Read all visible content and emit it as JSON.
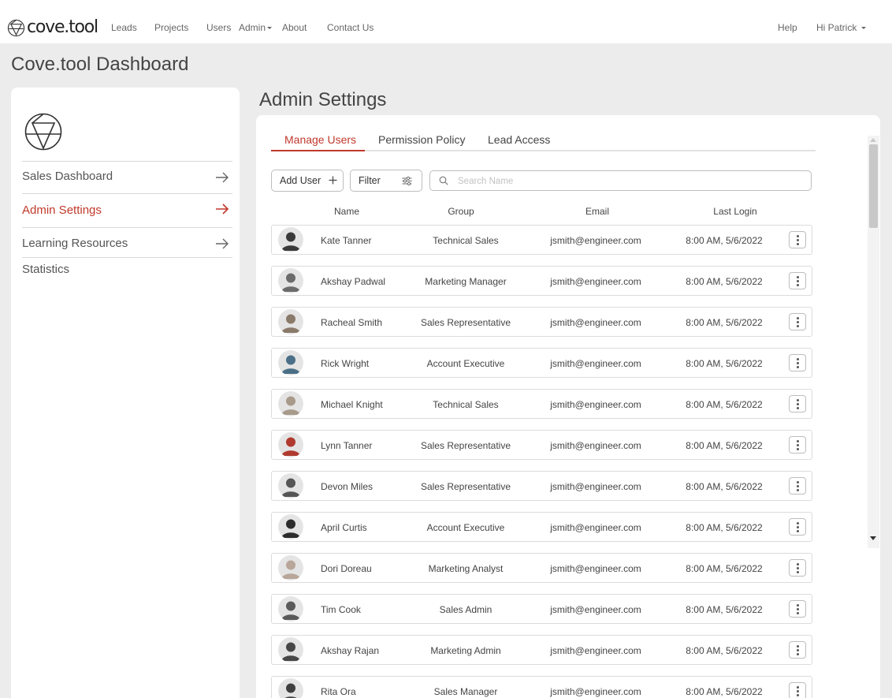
{
  "header": {
    "brand": "cove.tool",
    "nav": [
      "Leads",
      "Projects",
      "Users",
      "Admin",
      "About",
      "Contact Us"
    ],
    "help": "Help",
    "user_greeting": "Hi Patrick"
  },
  "page_title": "Cove.tool Dashboard",
  "sidebar": {
    "items": [
      {
        "label": "Sales Dashboard",
        "active": false
      },
      {
        "label": "Admin Settings",
        "active": true
      },
      {
        "label": "Learning Resources",
        "active": false
      },
      {
        "label": "Statistics",
        "active": false
      }
    ]
  },
  "main": {
    "title": "Admin Settings",
    "tabs": [
      {
        "label": "Manage Users",
        "active": true
      },
      {
        "label": "Permission Policy",
        "active": false
      },
      {
        "label": "Lead Access",
        "active": false
      }
    ],
    "add_user_label": "Add User",
    "filter_label": "Filter",
    "search": {
      "placeholder": "Search Name",
      "value": ""
    },
    "columns": [
      "Name",
      "Group",
      "Email",
      "Last Login"
    ],
    "rows": [
      {
        "name": "Kate Tanner",
        "group": "Technical Sales",
        "email": "jsmith@engineer.com",
        "last_login": "8:00 AM, 5/6/2022"
      },
      {
        "name": "Akshay Padwal",
        "group": "Marketing Manager",
        "email": "jsmith@engineer.com",
        "last_login": "8:00 AM, 5/6/2022"
      },
      {
        "name": "Racheal Smith",
        "group": "Sales Representative",
        "email": "jsmith@engineer.com",
        "last_login": "8:00 AM, 5/6/2022"
      },
      {
        "name": "Rick Wright",
        "group": "Account Executive",
        "email": "jsmith@engineer.com",
        "last_login": "8:00 AM, 5/6/2022"
      },
      {
        "name": "Michael Knight",
        "group": "Technical Sales",
        "email": "jsmith@engineer.com",
        "last_login": "8:00 AM, 5/6/2022"
      },
      {
        "name": "Lynn Tanner",
        "group": "Sales Representative",
        "email": "jsmith@engineer.com",
        "last_login": "8:00 AM, 5/6/2022"
      },
      {
        "name": "Devon Miles",
        "group": "Sales Representative",
        "email": "jsmith@engineer.com",
        "last_login": "8:00 AM, 5/6/2022"
      },
      {
        "name": "April Curtis",
        "group": "Account Executive",
        "email": "jsmith@engineer.com",
        "last_login": "8:00 AM, 5/6/2022"
      },
      {
        "name": "Dori Doreau",
        "group": "Marketing Analyst",
        "email": "jsmith@engineer.com",
        "last_login": "8:00 AM, 5/6/2022"
      },
      {
        "name": "Tim Cook",
        "group": "Sales Admin",
        "email": "jsmith@engineer.com",
        "last_login": "8:00 AM, 5/6/2022"
      },
      {
        "name": "Akshay Rajan",
        "group": "Marketing Admin",
        "email": "jsmith@engineer.com",
        "last_login": "8:00 AM, 5/6/2022"
      },
      {
        "name": "Rita Ora",
        "group": "Sales Manager",
        "email": "jsmith@engineer.com",
        "last_login": "8:00 AM, 5/6/2022"
      }
    ]
  },
  "icons": {
    "brand": "cove-logo-icon",
    "sidebar_arrow": "arrow-right-icon",
    "add": "plus-icon",
    "filter": "sliders-icon",
    "search": "search-icon",
    "row_menu": "kebab-menu-icon",
    "avatar": "avatar"
  },
  "colors": {
    "accent": "#c0392b",
    "background": "#ececec",
    "card": "#ffffff",
    "text": "#444444"
  }
}
